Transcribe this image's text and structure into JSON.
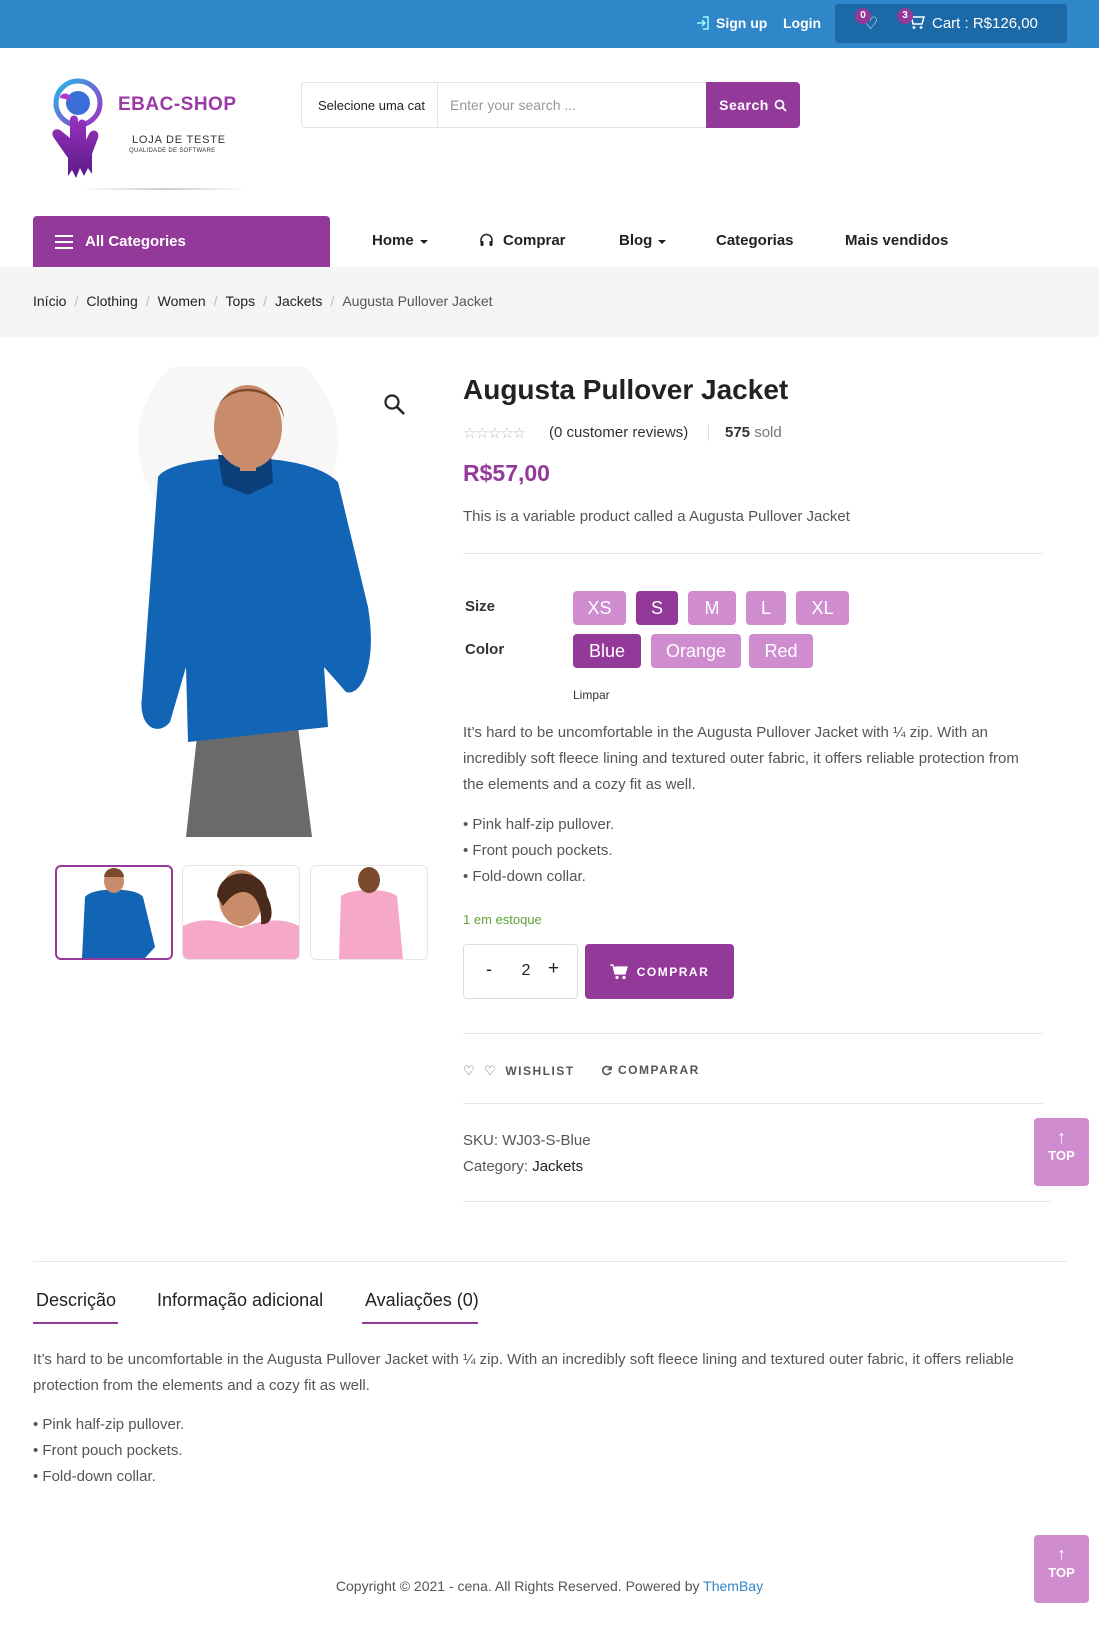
{
  "topbar": {
    "signup_label": "Sign up",
    "login_label": "Login",
    "wishlist_count": "0",
    "cart_count": "3",
    "cart_label": "Cart : R$126,00"
  },
  "logo": {
    "brand": "EBAC-SHOP",
    "tagline": "LOJA DE TESTE",
    "subtagline": "QUALIDADE DE SOFTWARE"
  },
  "search": {
    "category": "Selecione uma cat",
    "placeholder": "Enter your search ...",
    "button_label": "Search"
  },
  "nav": {
    "all_categories": "All Categories",
    "items": [
      "Home",
      "Comprar",
      "Blog",
      "Categorias",
      "Mais vendidos"
    ]
  },
  "breadcrumb": [
    "Início",
    "Clothing",
    "Women",
    "Tops",
    "Jackets",
    "Augusta Pullover Jacket"
  ],
  "product": {
    "title": "Augusta Pullover Jacket",
    "stars": "☆☆☆☆☆",
    "reviews": "(0 customer reviews)",
    "sold_count": "575",
    "sold_label": "sold",
    "price": "R$57,00",
    "short_description": "This is a variable product called a Augusta Pullover Jacket",
    "size_label": "Size",
    "sizes": [
      "XS",
      "S",
      "M",
      "L",
      "XL"
    ],
    "selected_size": "S",
    "color_label": "Color",
    "colors": [
      "Blue",
      "Orange",
      "Red"
    ],
    "selected_color": "Blue",
    "clear_label": "Limpar",
    "description_lines": [
      "It’s hard to be uncomfortable in the Augusta Pullover Jacket with ¼ zip. With an",
      "incredibly soft fleece lining and textured outer fabric, it offers reliable protection from",
      "the elements and a cozy fit as well."
    ],
    "bullets": [
      "• Pink half-zip pullover.",
      "• Front pouch pockets.",
      "• Fold-down collar."
    ],
    "stock": "1 em estoque",
    "quantity": "2",
    "qty_minus": "-",
    "qty_plus": "+",
    "buy_label": "COMPRAR",
    "wishlist_label": "WISHLIST",
    "compare_label": "COMPARAR",
    "sku_label": "SKU:",
    "sku": "WJ03-S-Blue",
    "category_label": "Category:",
    "category": "Jackets",
    "product_color": "#1264b5"
  },
  "back_to_top": "TOP",
  "tabs": {
    "items": [
      "Descrição",
      "Informação adicional",
      "Avaliações (0)"
    ],
    "description": "It’s hard to be uncomfortable in the Augusta Pullover Jacket with ¼ zip. With an incredibly soft fleece lining and textured outer fabric, it offers reliable protection from the elements and a cozy fit as well.",
    "bullets": [
      "• Pink half-zip pullover.",
      "• Front pouch pockets.",
      "• Fold-down collar."
    ]
  },
  "footer": {
    "copyright": "Copyright © 2021 - cena. All Rights Reserved. Powered by",
    "link": "ThemBay"
  },
  "colors": {
    "topbar": "#2f86c8",
    "accent": "#93399a",
    "swatch": "#cf8ccf",
    "stock": "#5fa03a"
  }
}
